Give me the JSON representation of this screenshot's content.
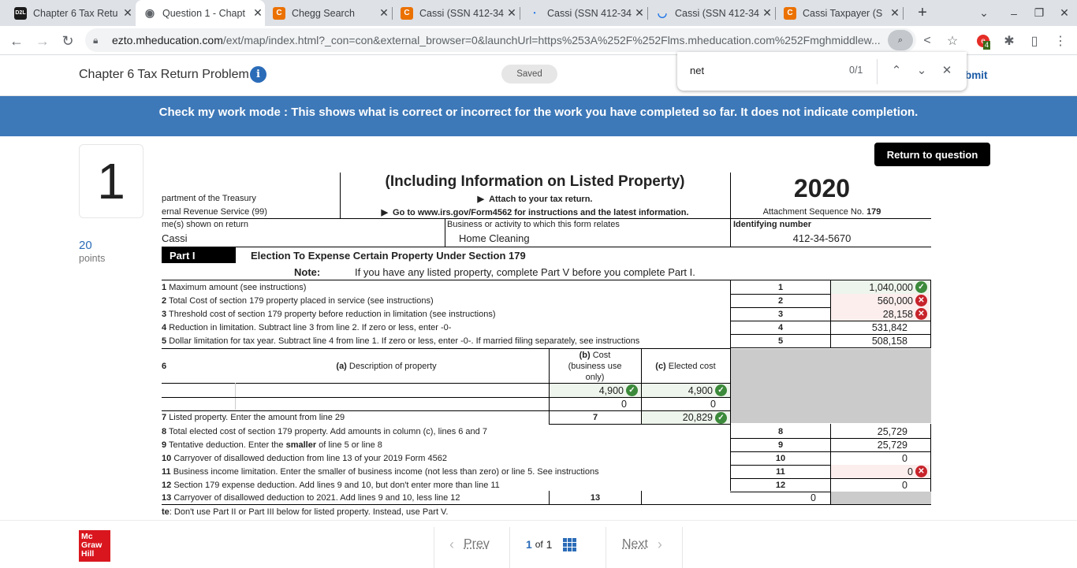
{
  "browser": {
    "tabs": [
      {
        "label": "Chapter 6 Tax Retu",
        "icon": "d2l-icon",
        "active": false
      },
      {
        "label": "Question 1 - Chapt",
        "icon": "globe-icon",
        "active": true
      },
      {
        "label": "Chegg Search",
        "icon": "chegg-icon",
        "active": false
      },
      {
        "label": "Cassi (SSN 412-34",
        "icon": "chegg-icon",
        "active": false
      },
      {
        "label": "Cassi (SSN 412-34",
        "icon": "loading-dot-icon",
        "active": false
      },
      {
        "label": "Cassi (SSN 412-34",
        "icon": "loading-spinner-icon",
        "active": false
      },
      {
        "label": "Cassi Taxpayer (S",
        "icon": "chegg-icon",
        "active": false
      }
    ],
    "url_host": "ezto.mheducation.com",
    "url_rest": "/ext/map/index.html?_con=con&external_browser=0&launchUrl=https%253A%252F%252Flms.mheducation.com%252Fmghmiddlew...",
    "extension_badge": "4",
    "find": {
      "query": "net",
      "count": "0/1"
    }
  },
  "header": {
    "title": "Chapter 6 Tax Return Problem",
    "saved_label": "Saved",
    "submit_label": "Submit",
    "submit_visible": "bmit"
  },
  "banner": "Check my work mode : This shows what is correct or incorrect for the work you have completed so far. It does not indicate completion.",
  "question": {
    "number": "1",
    "points": "20",
    "points_label": "points",
    "return_label": "Return to question"
  },
  "form": {
    "subtitle": "(Including Information on Listed Property)",
    "attach": "Attach to your tax return.",
    "goto": "Go to www.irs.gov/Form4562 for instructions and the latest information.",
    "dept": "partment of the Treasury",
    "irs": "ernal Revenue Service (99)",
    "year": "2020",
    "seq_label": "Attachment Sequence No.",
    "seq_no": "179",
    "name_label": "me(s) shown on return",
    "name": "Cassi",
    "business_label": "Business or activity to which this form relates",
    "business": "Home Cleaning",
    "id_label": "Identifying number",
    "id": "412-34-5670",
    "part_label": "Part I",
    "part_title": "Election To Expense Certain Property Under Section 179",
    "note_label": "Note:",
    "note_text": "If you have any listed property, complete Part V before you complete Part I.",
    "lines_top": [
      {
        "num": "1",
        "text": "Maximum amount (see instructions)",
        "box": "1",
        "value": "1,040,000",
        "status": "correct"
      },
      {
        "num": "2",
        "text": "Total Cost of section 179 property placed in service (see instructions)",
        "box": "2",
        "value": "560,000",
        "status": "incorrect"
      },
      {
        "num": "3",
        "text": "Threshold cost of section 179 property before reduction in limitation (see instructions)",
        "box": "3",
        "value": "28,158",
        "status": "incorrect"
      },
      {
        "num": "4",
        "text": "Reduction in limitation. Subtract line 3 from line 2. If zero or less, enter -0-",
        "box": "4",
        "value": "531,842",
        "status": "none"
      },
      {
        "num": "5",
        "text": "Dollar limitation for tax year. Subtract line 4 from line 1. If zero or less, enter -0-. If married filing separately, see instructions",
        "box": "5",
        "value": "508,158",
        "status": "none"
      }
    ],
    "line6": {
      "num": "6",
      "col_a": "Description of property",
      "col_a_prefix": "(a)",
      "col_b_prefix": "(b)",
      "col_b": "Cost (business use only)",
      "col_b_line1": "Cost",
      "col_b_line2": "(business use",
      "col_b_line3": "only)",
      "col_c_prefix": "(c)",
      "col_c": "Elected cost",
      "rows": [
        {
          "description": "",
          "cost": "4,900",
          "cost_status": "correct",
          "elected": "4,900",
          "elected_status": "correct"
        },
        {
          "description": "",
          "cost": "0",
          "cost_status": "none",
          "elected": "0",
          "elected_status": "none"
        }
      ]
    },
    "line7": {
      "num": "7",
      "text": "Listed property. Enter the amount from line 29",
      "box": "7",
      "value": "20,829",
      "status": "correct"
    },
    "lines_bottom": [
      {
        "num": "8",
        "text": "Total elected cost of section 179 property. Add amounts in column (c), lines 6 and 7",
        "box": "8",
        "value": "25,729",
        "status": "none"
      },
      {
        "num": "9",
        "text_pre": "Tentative deduction. Enter the ",
        "text_bold": "smaller",
        "text_post": " of line 5 or line 8",
        "box": "9",
        "value": "25,729",
        "status": "none"
      },
      {
        "num": "10",
        "text": "Carryover of disallowed deduction from line 13 of your 2019 Form 4562",
        "box": "10",
        "value": "0",
        "status": "none"
      },
      {
        "num": "11",
        "text": "Business income limitation. Enter the smaller of business income (not less than zero) or line 5. See instructions",
        "box": "11",
        "value": "0",
        "status": "incorrect"
      },
      {
        "num": "12",
        "text": "Section 179 expense deduction. Add lines 9 and 10, but don't enter more than line 11",
        "box": "12",
        "value": "0",
        "status": "none"
      }
    ],
    "line13": {
      "num": "13",
      "text": "Carryover of disallowed deduction to 2021. Add lines 9 and 10, less line 12",
      "box": "13",
      "value": "0"
    },
    "footnote_bold": "te",
    "footnote": ": Don't use Part II or Part III below for listed property. Instead, use Part V."
  },
  "footer": {
    "logo_lines": [
      "Mc",
      "Graw",
      "Hill"
    ],
    "prev_label": "Prev",
    "next_label": "Next",
    "page_current": "1",
    "page_of": "of",
    "page_total": "1"
  },
  "colors": {
    "banner": "#3d78b8",
    "correct": "#3c8a3b",
    "incorrect": "#c7232b",
    "accent": "#2b6cb8",
    "logo": "#d9161e"
  }
}
